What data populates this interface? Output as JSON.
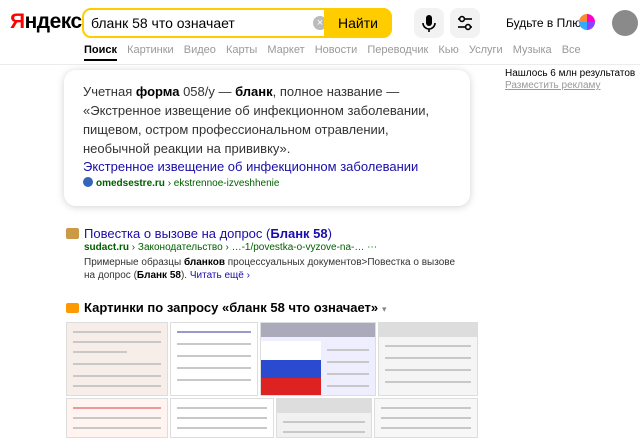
{
  "header": {
    "logo_first": "Я",
    "logo_rest": "ндекс",
    "search_value": "бланк 58 что означает",
    "search_button": "Найти",
    "plus_text": "Будьте в Плюсе"
  },
  "tabs": [
    "Поиск",
    "Картинки",
    "Видео",
    "Карты",
    "Маркет",
    "Новости",
    "Переводчик",
    "Кью",
    "Услуги",
    "Музыка",
    "Все"
  ],
  "aside": {
    "found": "Нашлось 6 млн результатов",
    "ads": "Разместить рекламу"
  },
  "card": {
    "s1": "Учетная ",
    "s2": "форма",
    "s3": " 058/у — ",
    "s4": "бланк",
    "s5": ", полное название — «Экстренное извещение об инфекционном заболевании, пищевом, остром профессиональном отравлении, необычной реакции на прививку».",
    "link": "Экстренное извещение об инфекционном заболевании",
    "domain": "omedsestre.ru",
    "path": " › ekstrennoe-izveshhenie"
  },
  "result2": {
    "title_a": "Повестка о вызове на допрос (",
    "title_b": "Бланк 58",
    "title_c": ")",
    "domain": "sudact.ru",
    "path": " › Законодательство › …-1/povestka-o-vyzove-na-… ⋯",
    "snip1": "Примерные образцы ",
    "snip2": "бланков",
    "snip3": " процессуальных документов>Повестка о вызове на допрос (",
    "snip4": "Бланк 58",
    "snip5": "). ",
    "more": "Читать ещё ›"
  },
  "images": {
    "title": "Картинки по запросу «бланк 58 что означает»",
    "arrow": "▾"
  }
}
